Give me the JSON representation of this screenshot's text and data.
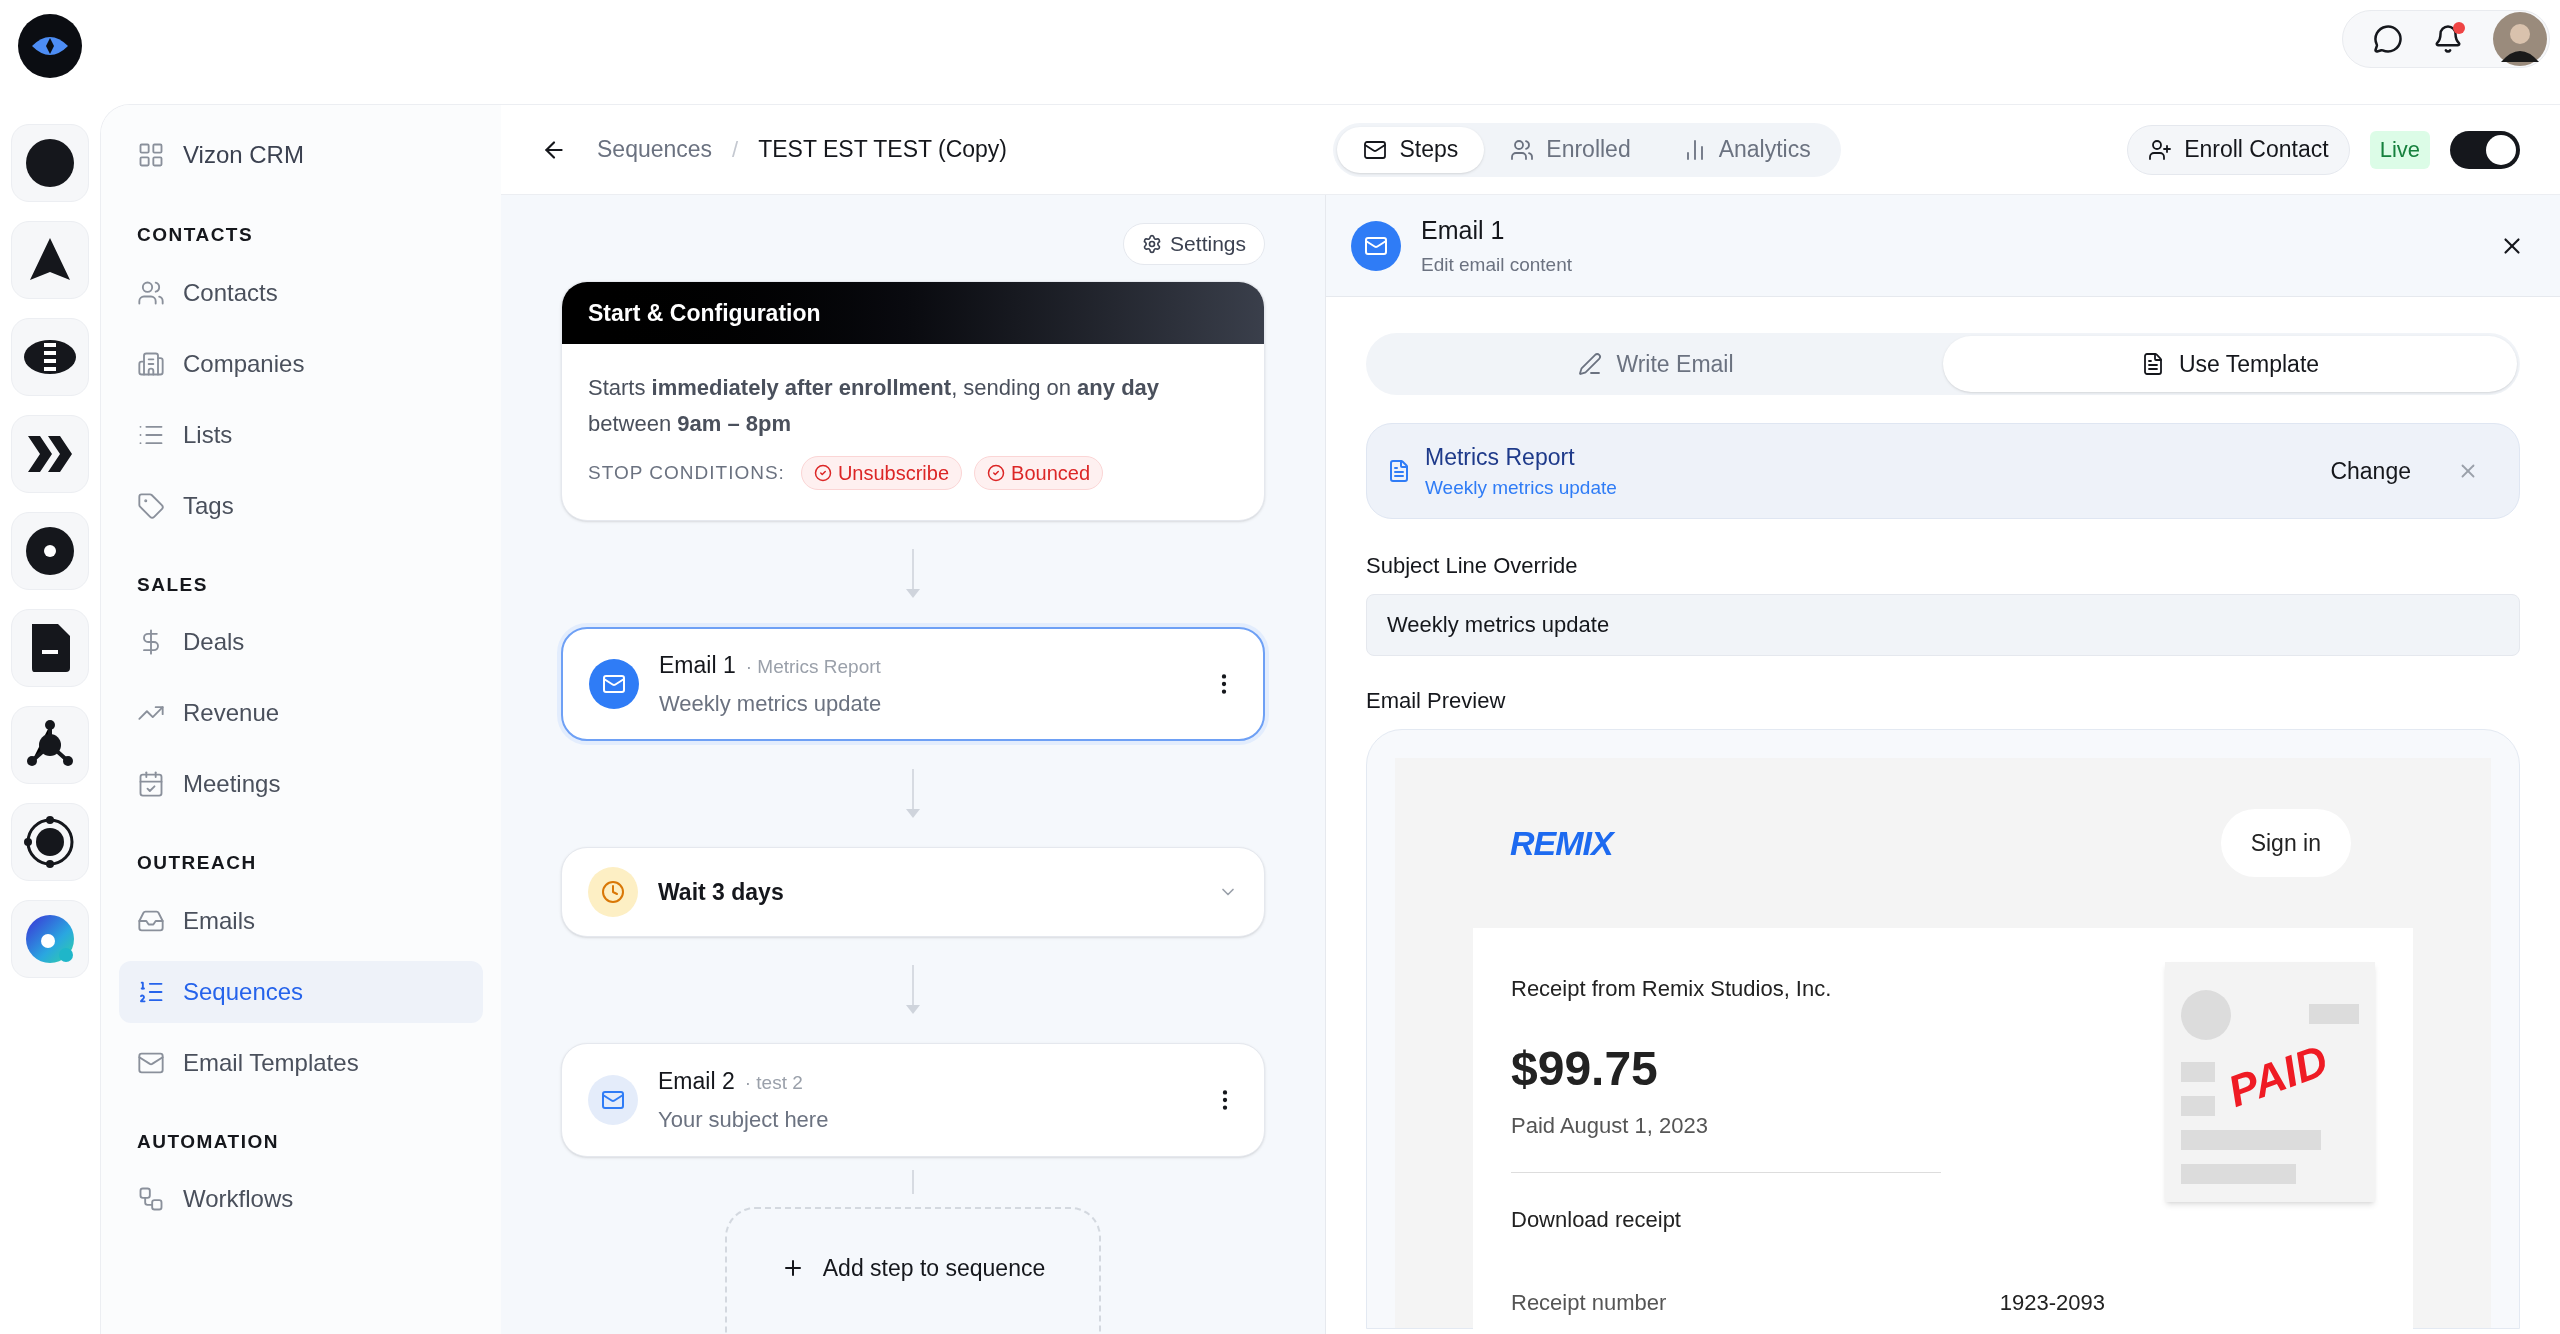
{
  "top_bar": {
    "has_unread_notifications": true
  },
  "sidebar": {
    "workspace": "Vizon CRM",
    "sections": [
      {
        "title": "CONTACTS",
        "items": [
          {
            "label": "Contacts",
            "selected": false
          },
          {
            "label": "Companies",
            "selected": false
          },
          {
            "label": "Lists",
            "selected": false
          },
          {
            "label": "Tags",
            "selected": false
          }
        ]
      },
      {
        "title": "SALES",
        "items": [
          {
            "label": "Deals",
            "selected": false
          },
          {
            "label": "Revenue",
            "selected": false
          },
          {
            "label": "Meetings",
            "selected": false
          }
        ]
      },
      {
        "title": "OUTREACH",
        "items": [
          {
            "label": "Emails",
            "selected": false
          },
          {
            "label": "Sequences",
            "selected": true
          },
          {
            "label": "Email Templates",
            "selected": false
          }
        ]
      },
      {
        "title": "AUTOMATION",
        "items": [
          {
            "label": "Workflows",
            "selected": false
          }
        ]
      }
    ]
  },
  "header": {
    "breadcrumb": [
      "Sequences",
      "TEST EST TEST (Copy)"
    ],
    "breadcrumb_separator": "/",
    "tabs": [
      {
        "label": "Steps",
        "selected": true
      },
      {
        "label": "Enrolled",
        "selected": false
      },
      {
        "label": "Analytics",
        "selected": false
      }
    ],
    "enroll_button": "Enroll Contact",
    "status_badge": "Live",
    "live_toggle": {
      "on": true
    }
  },
  "canvas": {
    "settings_button": "Settings",
    "start_card": {
      "title": "Start & Configuration",
      "description": "Starts **immediately after enrollment**, sending on **any day** between **9am – 8pm**",
      "stop_label": "STOP CONDITIONS:",
      "stop_conditions": [
        "Unsubscribe",
        "Bounced"
      ]
    },
    "steps": [
      {
        "kind": "email",
        "title": "Email 1",
        "template": "· Metrics Report",
        "subject": "Weekly metrics update",
        "selected": true
      },
      {
        "kind": "wait",
        "title": "Wait 3 days",
        "expanded": false
      },
      {
        "kind": "email",
        "title": "Email 2",
        "template": "· test 2",
        "subject": "Your subject here",
        "selected": false
      }
    ],
    "add_step": "Add step to sequence"
  },
  "editor": {
    "title": "Email 1",
    "subtitle": "Edit email content",
    "modes": [
      {
        "label": "Write Email",
        "selected": false
      },
      {
        "label": "Use Template",
        "selected": true
      }
    ],
    "template": {
      "name": "Metrics Report",
      "subject": "Weekly metrics update",
      "change": "Change"
    },
    "subject_label": "Subject Line Override",
    "subject_value": "Weekly metrics update",
    "preview_label": "Email Preview",
    "preview": {
      "brand": "REMIX",
      "sign_in": "Sign in",
      "from": "Receipt from Remix Studios, Inc.",
      "amount": "$99.75",
      "paid_date": "Paid August 1, 2023",
      "download": "Download receipt",
      "receipt_label": "Receipt number",
      "receipt_number": "1923-2093",
      "stamp": "PAID"
    }
  }
}
